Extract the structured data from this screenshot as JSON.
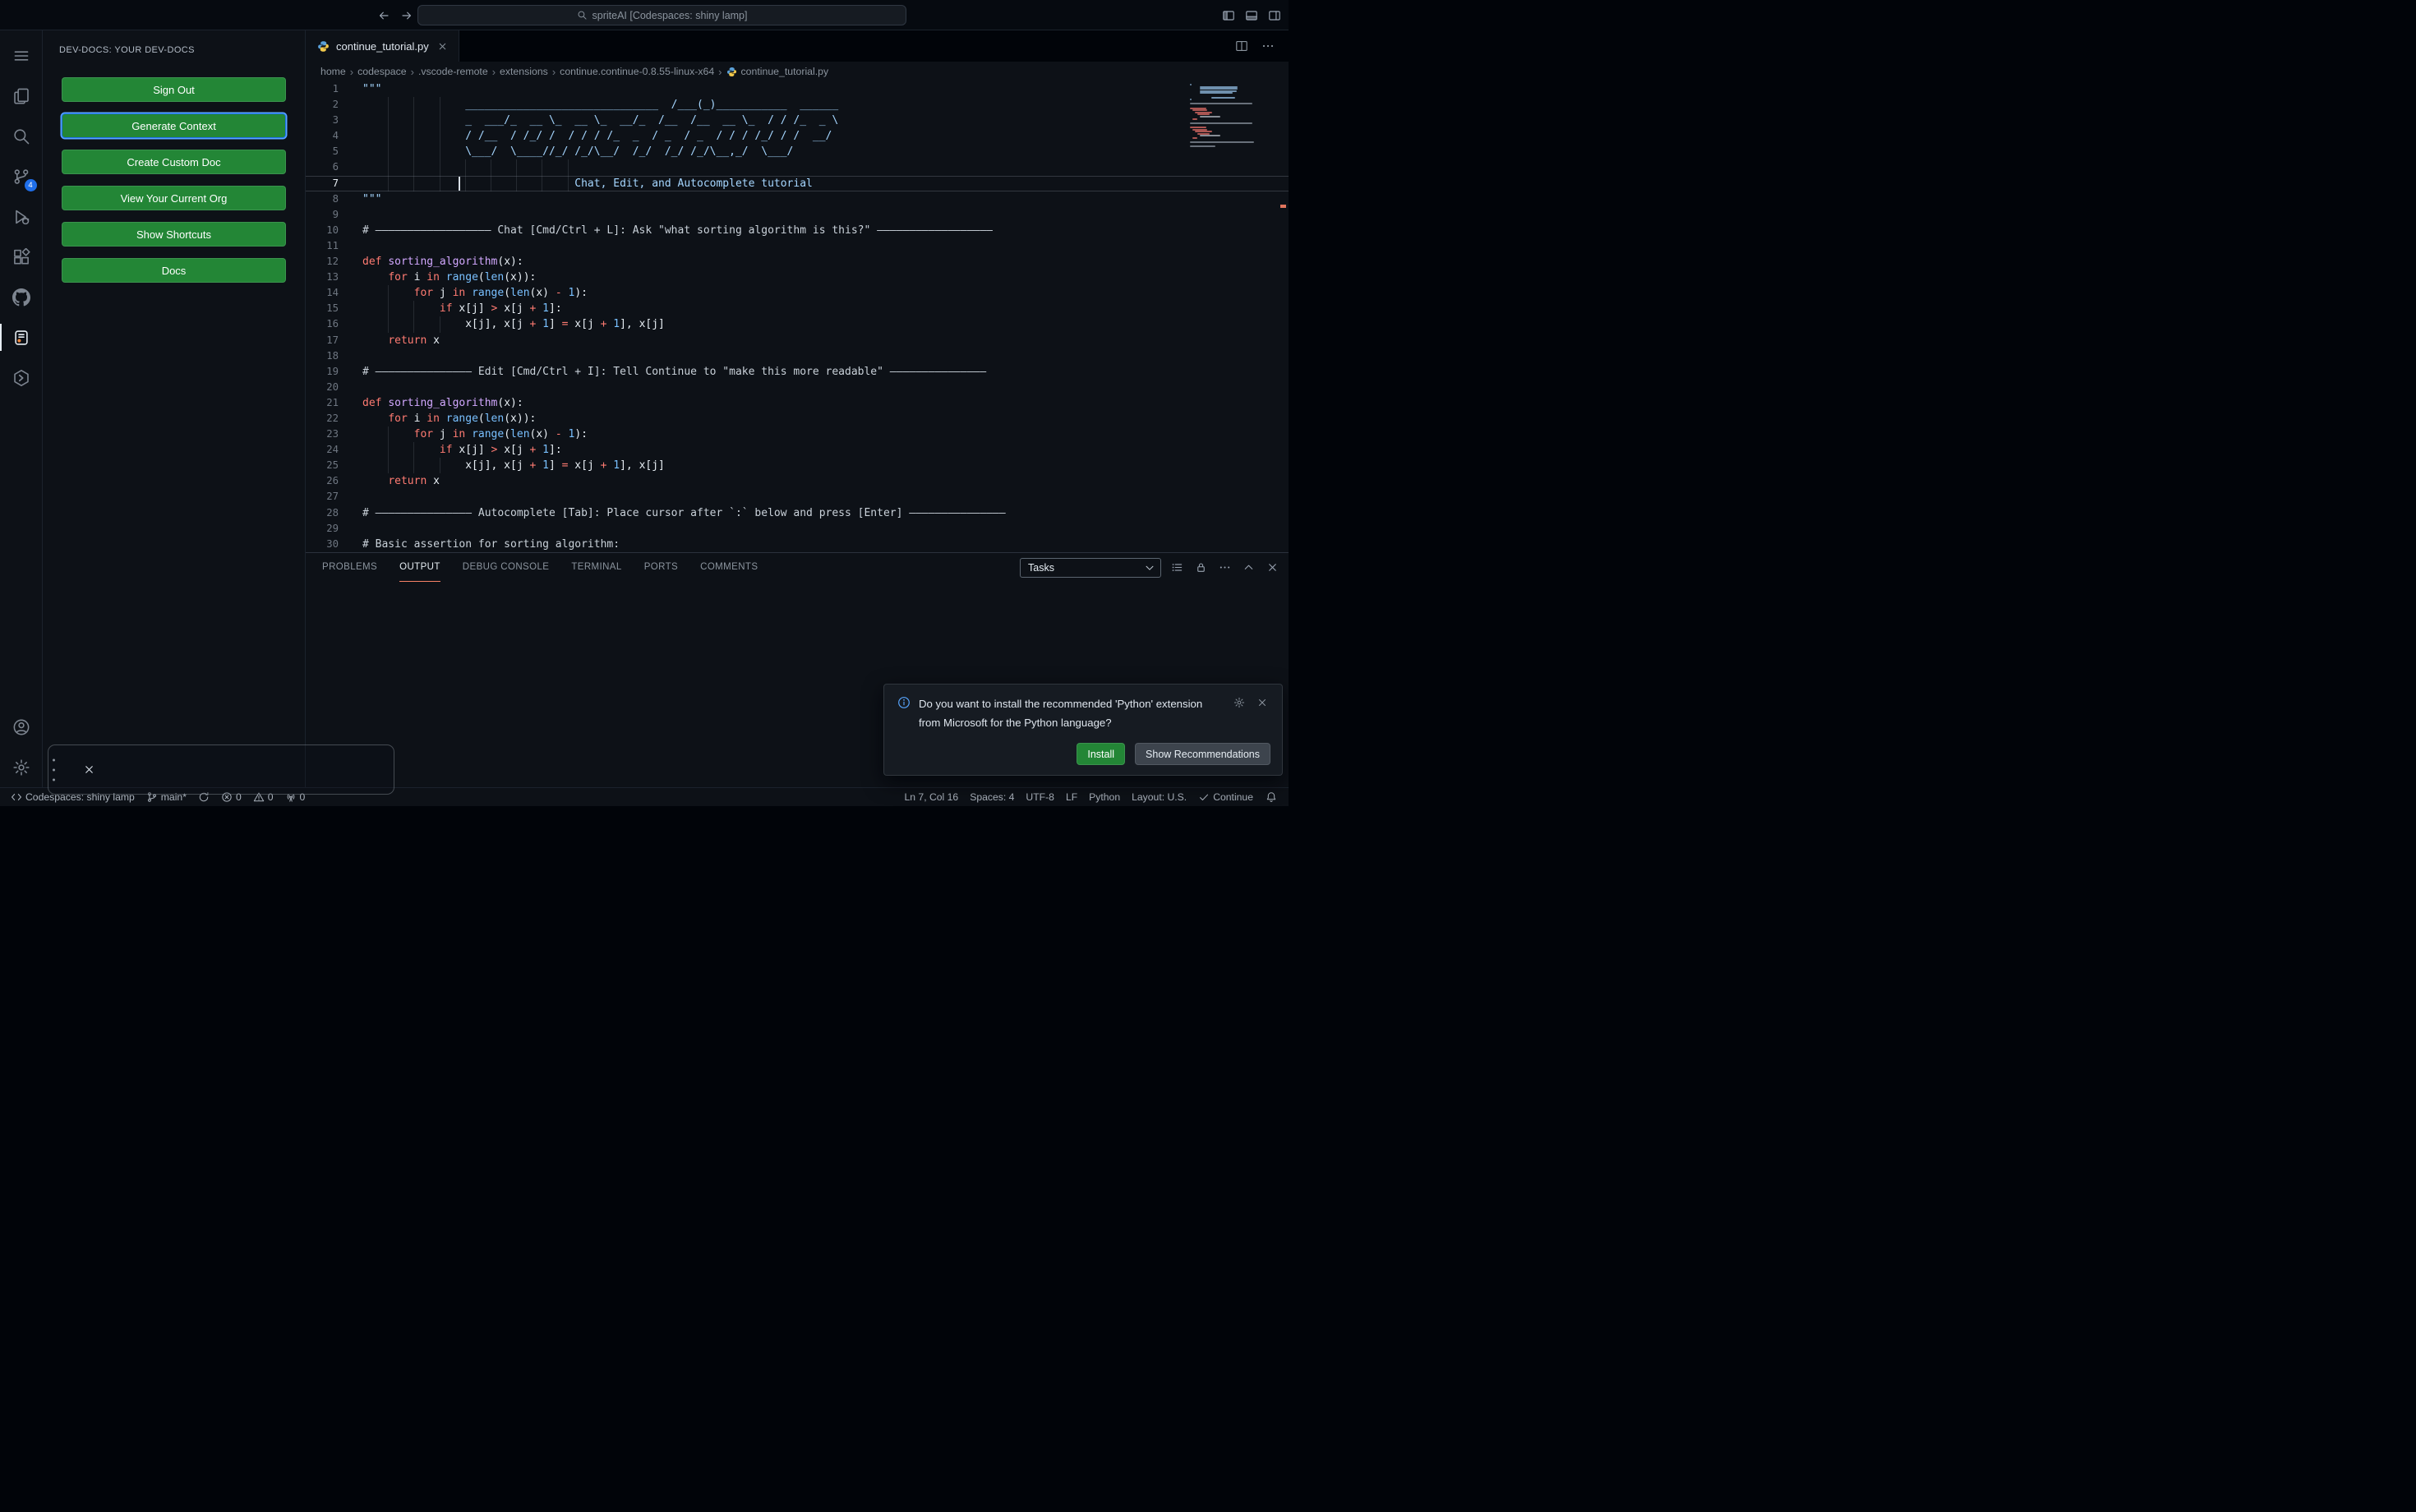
{
  "title_bar": {
    "search_text": "spriteAI [Codespaces: shiny lamp]"
  },
  "activity_bar": {
    "items": [
      {
        "id": "menu",
        "active": false
      },
      {
        "id": "explorer",
        "active": false
      },
      {
        "id": "search",
        "active": false
      },
      {
        "id": "source-control",
        "active": false,
        "badge": "4"
      },
      {
        "id": "run-debug",
        "active": false
      },
      {
        "id": "extensions",
        "active": false
      },
      {
        "id": "github",
        "active": false
      },
      {
        "id": "dev-docs",
        "active": true
      },
      {
        "id": "continue",
        "active": false
      }
    ],
    "bottom_items": [
      {
        "id": "account",
        "active": false
      },
      {
        "id": "settings",
        "active": false
      }
    ]
  },
  "sidebar": {
    "title": "DEV-DOCS: YOUR DEV-DOCS",
    "buttons": [
      {
        "label": "Sign Out",
        "focused": false
      },
      {
        "label": "Generate Context",
        "focused": true
      },
      {
        "label": "Create Custom Doc",
        "focused": false
      },
      {
        "label": "View Your Current Org",
        "focused": false
      },
      {
        "label": "Show Shortcuts",
        "focused": false
      },
      {
        "label": "Docs",
        "focused": false
      }
    ]
  },
  "editor": {
    "tab_label": "continue_tutorial.py",
    "breadcrumbs": [
      "home",
      "codespace",
      ".vscode-remote",
      "extensions",
      "continue.continue-0.8.55-linux-x64"
    ],
    "breadcrumb_file": "continue_tutorial.py",
    "active_line": 7,
    "cursor_col": 16,
    "lines": [
      {
        "n": 1,
        "t": [
          [
            "str",
            "\"\"\""
          ]
        ]
      },
      {
        "n": 2,
        "t": [
          [
            "str",
            "                ______________________________  /___(_)___________  ______"
          ]
        ]
      },
      {
        "n": 3,
        "t": [
          [
            "str",
            "                _  ___/_  __ \\_  __ \\_  __/_  /__  /__  __ \\_  / / /_  _ \\"
          ]
        ]
      },
      {
        "n": 4,
        "t": [
          [
            "str",
            "                / /__  / /_/ /  / / / /_  _  / _  / _  / / / /_/ / /  __/"
          ]
        ]
      },
      {
        "n": 5,
        "t": [
          [
            "str",
            "                \\___/  \\____//_/ /_/\\__/  /_/  /_/ /_/\\__,_/  \\___/"
          ]
        ]
      },
      {
        "n": 6,
        "t": []
      },
      {
        "n": 7,
        "t": [
          [
            "str",
            "                                 Chat, Edit, and Autocomplete tutorial"
          ]
        ]
      },
      {
        "n": 8,
        "t": [
          [
            "str",
            "\"\"\""
          ]
        ]
      },
      {
        "n": 9,
        "t": []
      },
      {
        "n": 10,
        "t": [
          [
            "com",
            "# —————————————————— Chat [Cmd/Ctrl + L]: Ask \"what sorting algorithm is this?\" ——————————————————"
          ]
        ]
      },
      {
        "n": 11,
        "t": []
      },
      {
        "n": 12,
        "t": [
          [
            "kw",
            "def"
          ],
          [
            "pl",
            " "
          ],
          [
            "fn",
            "sorting_algorithm"
          ],
          [
            "pl",
            "(x):"
          ]
        ]
      },
      {
        "n": 13,
        "t": [
          [
            "pl",
            "    "
          ],
          [
            "kw",
            "for"
          ],
          [
            "pl",
            " i "
          ],
          [
            "kw",
            "in"
          ],
          [
            "pl",
            " "
          ],
          [
            "bi",
            "range"
          ],
          [
            "pl",
            "("
          ],
          [
            "bi",
            "len"
          ],
          [
            "pl",
            "(x)):"
          ]
        ]
      },
      {
        "n": 14,
        "t": [
          [
            "pl",
            "        "
          ],
          [
            "kw",
            "for"
          ],
          [
            "pl",
            " j "
          ],
          [
            "kw",
            "in"
          ],
          [
            "pl",
            " "
          ],
          [
            "bi",
            "range"
          ],
          [
            "pl",
            "("
          ],
          [
            "bi",
            "len"
          ],
          [
            "pl",
            "(x) "
          ],
          [
            "op",
            "-"
          ],
          [
            "pl",
            " "
          ],
          [
            "num",
            "1"
          ],
          [
            "pl",
            "):"
          ]
        ]
      },
      {
        "n": 15,
        "t": [
          [
            "pl",
            "            "
          ],
          [
            "kw",
            "if"
          ],
          [
            "pl",
            " x[j] "
          ],
          [
            "op",
            ">"
          ],
          [
            "pl",
            " x[j "
          ],
          [
            "op",
            "+"
          ],
          [
            "pl",
            " "
          ],
          [
            "num",
            "1"
          ],
          [
            "pl",
            "]:"
          ]
        ]
      },
      {
        "n": 16,
        "t": [
          [
            "pl",
            "                x[j], x[j "
          ],
          [
            "op",
            "+"
          ],
          [
            "pl",
            " "
          ],
          [
            "num",
            "1"
          ],
          [
            "pl",
            "] "
          ],
          [
            "op",
            "="
          ],
          [
            "pl",
            " x[j "
          ],
          [
            "op",
            "+"
          ],
          [
            "pl",
            " "
          ],
          [
            "num",
            "1"
          ],
          [
            "pl",
            "], x[j]"
          ]
        ]
      },
      {
        "n": 17,
        "t": [
          [
            "pl",
            "    "
          ],
          [
            "kw",
            "return"
          ],
          [
            "pl",
            " x"
          ]
        ]
      },
      {
        "n": 18,
        "t": []
      },
      {
        "n": 19,
        "t": [
          [
            "com",
            "# ——————————————— Edit [Cmd/Ctrl + I]: Tell Continue to \"make this more readable\" ———————————————"
          ]
        ]
      },
      {
        "n": 20,
        "t": []
      },
      {
        "n": 21,
        "t": [
          [
            "kw",
            "def"
          ],
          [
            "pl",
            " "
          ],
          [
            "fn",
            "sorting_algorithm"
          ],
          [
            "pl",
            "(x):"
          ]
        ]
      },
      {
        "n": 22,
        "t": [
          [
            "pl",
            "    "
          ],
          [
            "kw",
            "for"
          ],
          [
            "pl",
            " i "
          ],
          [
            "kw",
            "in"
          ],
          [
            "pl",
            " "
          ],
          [
            "bi",
            "range"
          ],
          [
            "pl",
            "("
          ],
          [
            "bi",
            "len"
          ],
          [
            "pl",
            "(x)):"
          ]
        ]
      },
      {
        "n": 23,
        "t": [
          [
            "pl",
            "        "
          ],
          [
            "kw",
            "for"
          ],
          [
            "pl",
            " j "
          ],
          [
            "kw",
            "in"
          ],
          [
            "pl",
            " "
          ],
          [
            "bi",
            "range"
          ],
          [
            "pl",
            "("
          ],
          [
            "bi",
            "len"
          ],
          [
            "pl",
            "(x) "
          ],
          [
            "op",
            "-"
          ],
          [
            "pl",
            " "
          ],
          [
            "num",
            "1"
          ],
          [
            "pl",
            "):"
          ]
        ]
      },
      {
        "n": 24,
        "t": [
          [
            "pl",
            "            "
          ],
          [
            "kw",
            "if"
          ],
          [
            "pl",
            " x[j] "
          ],
          [
            "op",
            ">"
          ],
          [
            "pl",
            " x[j "
          ],
          [
            "op",
            "+"
          ],
          [
            "pl",
            " "
          ],
          [
            "num",
            "1"
          ],
          [
            "pl",
            "]:"
          ]
        ]
      },
      {
        "n": 25,
        "t": [
          [
            "pl",
            "                x[j], x[j "
          ],
          [
            "op",
            "+"
          ],
          [
            "pl",
            " "
          ],
          [
            "num",
            "1"
          ],
          [
            "pl",
            "] "
          ],
          [
            "op",
            "="
          ],
          [
            "pl",
            " x[j "
          ],
          [
            "op",
            "+"
          ],
          [
            "pl",
            " "
          ],
          [
            "num",
            "1"
          ],
          [
            "pl",
            "], x[j]"
          ]
        ]
      },
      {
        "n": 26,
        "t": [
          [
            "pl",
            "    "
          ],
          [
            "kw",
            "return"
          ],
          [
            "pl",
            " x"
          ]
        ]
      },
      {
        "n": 27,
        "t": []
      },
      {
        "n": 28,
        "t": [
          [
            "com",
            "# ——————————————— Autocomplete [Tab]: Place cursor after `:` below and press [Enter] ———————————————"
          ]
        ]
      },
      {
        "n": 29,
        "t": []
      },
      {
        "n": 30,
        "t": [
          [
            "com",
            "# Basic assertion for sorting algorithm:"
          ]
        ]
      }
    ]
  },
  "panel": {
    "tabs": [
      {
        "label": "PROBLEMS",
        "active": false
      },
      {
        "label": "OUTPUT",
        "active": true
      },
      {
        "label": "DEBUG CONSOLE",
        "active": false
      },
      {
        "label": "TERMINAL",
        "active": false
      },
      {
        "label": "PORTS",
        "active": false
      },
      {
        "label": "COMMENTS",
        "active": false
      }
    ],
    "tasks_label": "Tasks"
  },
  "notification": {
    "message": "Do you want to install the recommended 'Python' extension from Microsoft for the Python language?",
    "install_label": "Install",
    "show_recommendations_label": "Show Recommendations"
  },
  "status_bar": {
    "left": [
      {
        "icon": "remote",
        "label": "Codespaces: shiny lamp"
      },
      {
        "icon": "branch",
        "label": "main*"
      },
      {
        "icon": "sync",
        "label": ""
      },
      {
        "icon": "error",
        "label": "0"
      },
      {
        "icon": "warning",
        "label": "0"
      },
      {
        "icon": "ports",
        "label": "0"
      }
    ],
    "right": [
      {
        "icon": "",
        "label": "Ln 7, Col 16"
      },
      {
        "icon": "",
        "label": "Spaces: 4"
      },
      {
        "icon": "",
        "label": "UTF-8"
      },
      {
        "icon": "",
        "label": "LF"
      },
      {
        "icon": "",
        "label": "Python"
      },
      {
        "icon": "",
        "label": "Layout: U.S."
      },
      {
        "icon": "check",
        "label": "Continue"
      }
    ]
  },
  "colors": {
    "background": "#0d1117",
    "accent_green": "#238636",
    "focus_blue": "#58a6ff",
    "panel_tab_accent": "#f78166",
    "badge_blue": "#1f6feb",
    "string_blue": "#a5d6ff",
    "keyword_red": "#ff7b72"
  }
}
